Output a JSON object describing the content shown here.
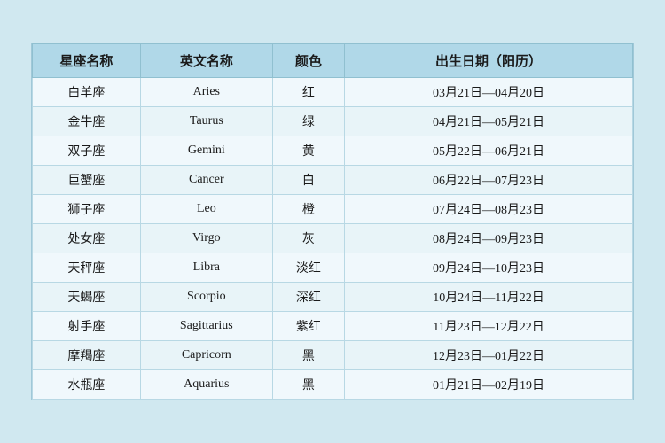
{
  "table": {
    "headers": {
      "zh_name": "星座名称",
      "en_name": "英文名称",
      "color": "颜色",
      "date": "出生日期（阳历）"
    },
    "rows": [
      {
        "zh": "白羊座",
        "en": "Aries",
        "color": "红",
        "date": "03月21日—04月20日"
      },
      {
        "zh": "金牛座",
        "en": "Taurus",
        "color": "绿",
        "date": "04月21日—05月21日"
      },
      {
        "zh": "双子座",
        "en": "Gemini",
        "color": "黄",
        "date": "05月22日—06月21日"
      },
      {
        "zh": "巨蟹座",
        "en": "Cancer",
        "color": "白",
        "date": "06月22日—07月23日"
      },
      {
        "zh": "狮子座",
        "en": "Leo",
        "color": "橙",
        "date": "07月24日—08月23日"
      },
      {
        "zh": "处女座",
        "en": "Virgo",
        "color": "灰",
        "date": "08月24日—09月23日"
      },
      {
        "zh": "天秤座",
        "en": "Libra",
        "color": "淡红",
        "date": "09月24日—10月23日"
      },
      {
        "zh": "天蝎座",
        "en": "Scorpio",
        "color": "深红",
        "date": "10月24日—11月22日"
      },
      {
        "zh": "射手座",
        "en": "Sagittarius",
        "color": "紫红",
        "date": "11月23日—12月22日"
      },
      {
        "zh": "摩羯座",
        "en": "Capricorn",
        "color": "黑",
        "date": "12月23日—01月22日"
      },
      {
        "zh": "水瓶座",
        "en": "Aquarius",
        "color": "黑",
        "date": "01月21日—02月19日"
      }
    ]
  }
}
